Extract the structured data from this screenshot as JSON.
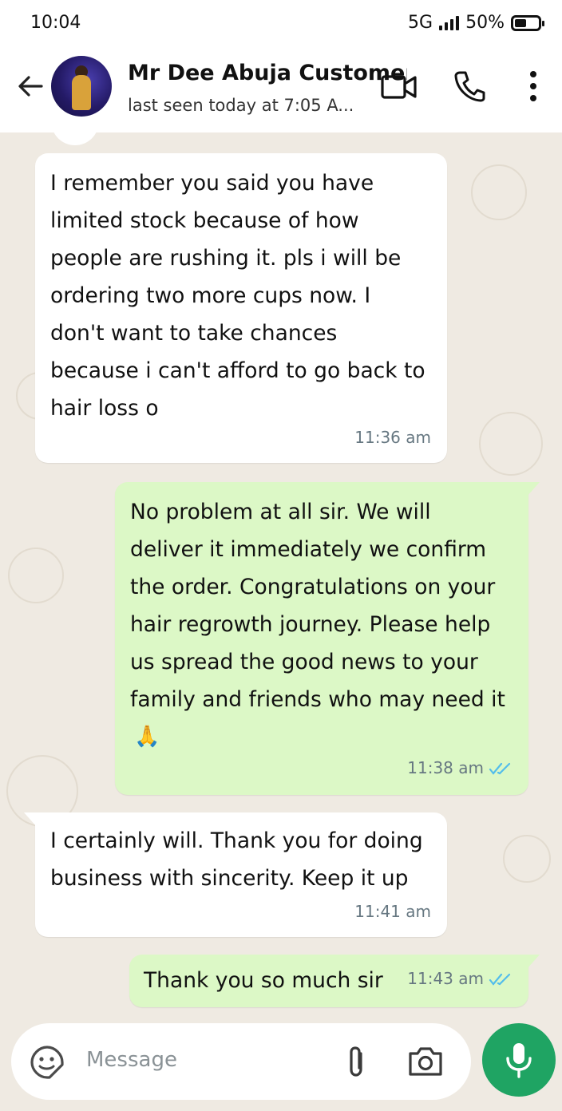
{
  "status_bar": {
    "time": "10:04",
    "network": "5G",
    "battery_text": "50%",
    "battery_level": 0.5
  },
  "header": {
    "contact_name": "Mr Dee Abuja Customer",
    "last_seen": "last seen today at 7:05 A...",
    "icons": [
      "back-arrow-icon",
      "video-call-icon",
      "phone-icon",
      "more-vertical-icon"
    ]
  },
  "messages": [
    {
      "direction": "incoming",
      "text": "I remember you said you have\nlimited stock because of how\npeople are rushing it. pls i will be\nordering two more cups now. I\ndon't want to take chances\nbecause i can't afford to go back to\nhair loss o",
      "time": "11:36 am"
    },
    {
      "direction": "outgoing",
      "text": "No problem at all sir. We will\ndeliver it immediately we confirm\nthe order. Congratulations on your\nhair regrowth journey. Please help\nus spread the good news to your\nfamily and friends who may need it",
      "emoji": "🙏",
      "time": "11:38 am",
      "status": "read"
    },
    {
      "direction": "incoming",
      "text": "I certainly will. Thank you for doing\nbusiness with sincerity. Keep it up",
      "time": "11:41 am"
    },
    {
      "direction": "outgoing",
      "text": "Thank you so much sir",
      "time": "11:43 am",
      "status": "read"
    }
  ],
  "composer": {
    "placeholder": "Message",
    "icons": [
      "sticker-icon",
      "attach-icon",
      "camera-icon",
      "mic-icon"
    ]
  },
  "colors": {
    "chat_background": "#efeae2",
    "outgoing_bubble": "#dcf8c6",
    "incoming_bubble": "#ffffff",
    "accent_green": "#1fa463",
    "read_tick": "#53bdeb"
  }
}
